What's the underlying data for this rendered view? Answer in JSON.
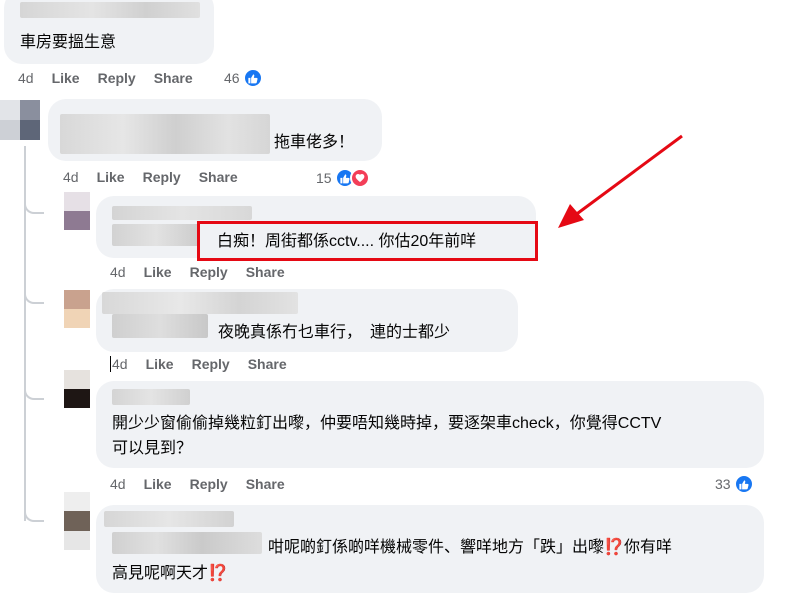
{
  "comments": [
    {
      "text": "車房要搵生意",
      "time": "4d",
      "like": "Like",
      "reply": "Reply",
      "share": "Share",
      "reactions": "46"
    },
    {
      "text": "拖車佬多！",
      "time": "4d",
      "like": "Like",
      "reply": "Reply",
      "share": "Share",
      "reactions": "15"
    },
    {
      "text": "白痴！周街都係cctv.... 你估20年前咩",
      "time": "4d",
      "like": "Like",
      "reply": "Reply",
      "share": "Share"
    },
    {
      "text": "夜晚真係冇乜車行， 連的士都少",
      "time": "4d",
      "like": "Like",
      "reply": "Reply",
      "share": "Share"
    },
    {
      "text_line1": "開少少窗偷偷掉幾粒釘出嚟，仲要唔知幾時掉，要逐架車check，你覺得CCTV",
      "text_line2": "可以見到？",
      "time": "4d",
      "like": "Like",
      "reply": "Reply",
      "share": "Share",
      "reactions": "33"
    },
    {
      "text_line1": "咁呢啲釘係啲咩機械零件、響咩地方「跌」出嚟",
      "text_line1_end": "你有咩",
      "text_line2": "高見呢啊天才",
      "emoji": "⁉️"
    }
  ],
  "colors": {
    "bubble": "#f0f2f5",
    "meta": "#65676b",
    "like_blue": "#1877f2",
    "love_red": "#f33e58",
    "highlight_red": "#e50914",
    "arrow_red": "#e50914"
  },
  "icons": [
    "like-reaction-icon",
    "love-reaction-icon",
    "red-arrow-annotation"
  ]
}
